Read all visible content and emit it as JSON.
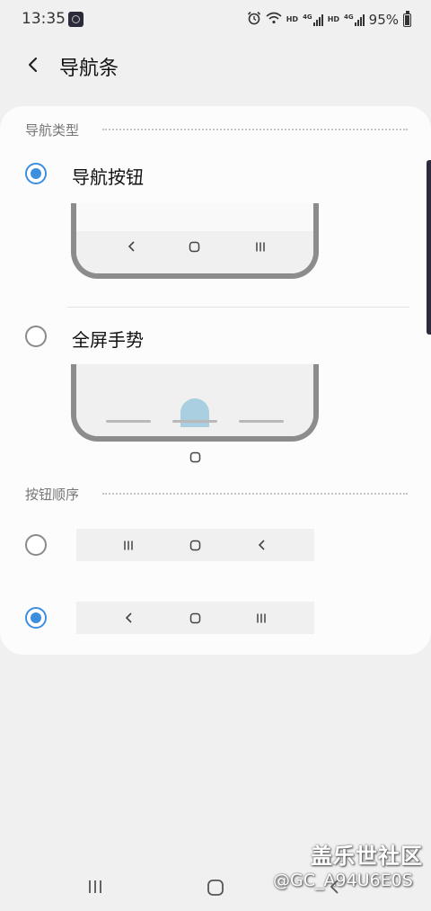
{
  "status_bar": {
    "time": "13:35",
    "battery": "95%",
    "hd_label_1": "HD",
    "hd_label_2": "HD",
    "net_label_1": "4G",
    "net_label_2": "4G",
    "icons": [
      "alarm-icon",
      "wifi-icon",
      "signal-icon",
      "signal-icon",
      "battery-icon"
    ]
  },
  "header": {
    "title": "导航条"
  },
  "nav_type": {
    "section_title": "导航类型",
    "options": [
      {
        "label": "导航按钮",
        "selected": true
      },
      {
        "label": "全屏手势",
        "selected": false
      }
    ]
  },
  "button_order": {
    "section_title": "按钮顺序",
    "options": [
      {
        "icons": [
          "recents-icon",
          "home-icon",
          "back-icon"
        ],
        "selected": false
      },
      {
        "icons": [
          "back-icon",
          "home-icon",
          "recents-icon"
        ],
        "selected": true
      }
    ]
  },
  "watermark": {
    "brand": "盖乐世社区",
    "user": "@GC_A94U6E0S"
  },
  "colors": {
    "accent": "#3e8ee0",
    "background": "#f0f0f0",
    "card": "#fcfcfc",
    "gesture_handle": "#a9cfe0"
  }
}
